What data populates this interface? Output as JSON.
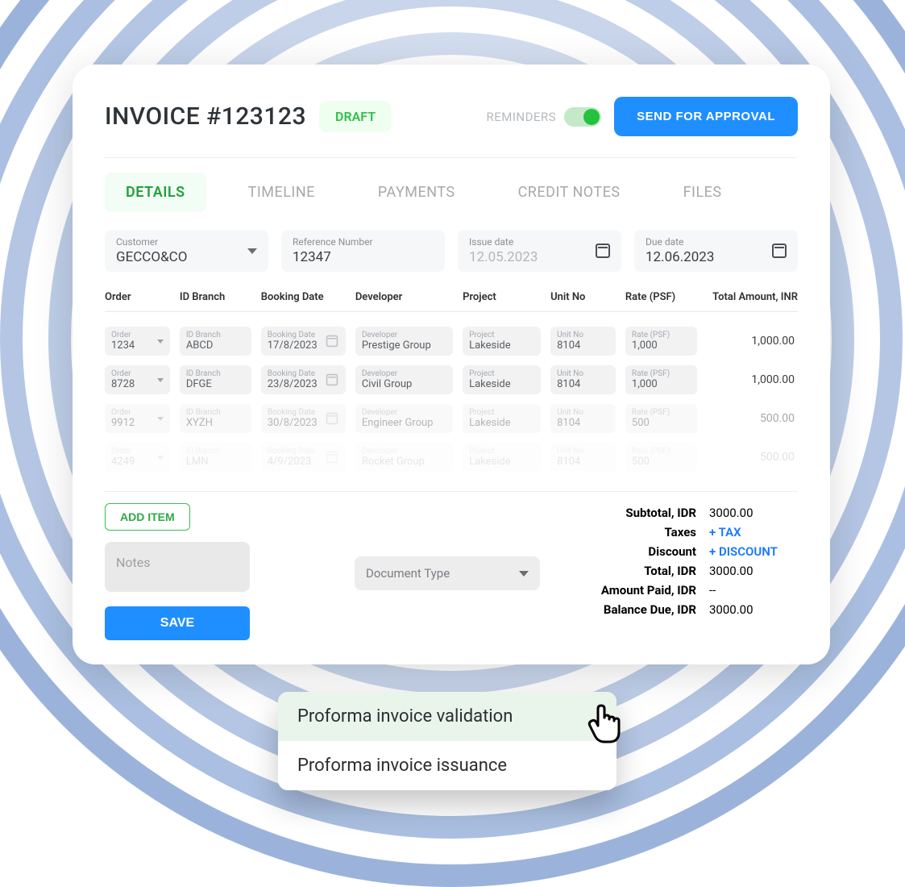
{
  "header": {
    "title": "INVOICE #123123",
    "status": "DRAFT",
    "reminders_label": "REMINDERS",
    "approve_label": "SEND FOR APPROVAL"
  },
  "tabs": [
    "DETAILS",
    "TIMELINE",
    "PAYMENTS",
    "CREDIT NOTES",
    "FILES"
  ],
  "fields": {
    "customer": {
      "label": "Customer",
      "value": "GECCO&CO"
    },
    "reference": {
      "label": "Reference Number",
      "value": "12347"
    },
    "issue": {
      "label": "Issue date",
      "value": "12.05.2023"
    },
    "due": {
      "label": "Due date",
      "value": "12.06.2023"
    }
  },
  "columns": [
    "Order",
    "ID Branch",
    "Booking Date",
    "Developer",
    "Project",
    "Unit No",
    "Rate (PSF)",
    "Total Amount, INR"
  ],
  "lines": [
    {
      "order": "1234",
      "branch": "ABCD",
      "booking": "17/8/2023",
      "developer": "Prestige Group",
      "project": "Lakeside",
      "unit": "8104",
      "rate": "1,000",
      "amount": "1,000.00",
      "fade": ""
    },
    {
      "order": "8728",
      "branch": "DFGE",
      "booking": "23/8/2023",
      "developer": "Civil Group",
      "project": "Lakeside",
      "unit": "8104",
      "rate": "1,000",
      "amount": "1,000.00",
      "fade": ""
    },
    {
      "order": "9912",
      "branch": "XYZH",
      "booking": "30/8/2023",
      "developer": "Engineer Group",
      "project": "Lakeside",
      "unit": "8104",
      "rate": "500",
      "amount": "500.00",
      "fade": "fade2"
    },
    {
      "order": "4249",
      "branch": "LMN",
      "booking": "4/9/2023",
      "developer": "Rocket Group",
      "project": "Lakeside",
      "unit": "8104",
      "rate": "500",
      "amount": "500.00",
      "fade": "fade3"
    }
  ],
  "cell_labels": {
    "order": "Order",
    "branch": "ID Branch",
    "booking": "Booking Date",
    "developer": "Developer",
    "project": "Project",
    "unit": "Unit No",
    "rate": "Rate (PSF)"
  },
  "actions": {
    "add_item": "ADD ITEM",
    "notes_placeholder": "Notes",
    "doctype_label": "Document Type",
    "save": "SAVE"
  },
  "totals": [
    {
      "label": "Subtotal, IDR",
      "value": "3000.00",
      "link": false
    },
    {
      "label": "Taxes",
      "value": "+ TAX",
      "link": true
    },
    {
      "label": "Discount",
      "value": "+ DISCOUNT",
      "link": true
    },
    {
      "label": "Total, IDR",
      "value": "3000.00",
      "link": false
    },
    {
      "label": "Amount Paid, IDR",
      "value": "--",
      "link": false
    },
    {
      "label": "Balance Due, IDR",
      "value": "3000.00",
      "link": false
    }
  ],
  "doctype_options": [
    {
      "label": "Proforma invoice validation",
      "selected": true
    },
    {
      "label": "Proforma invoice issuance",
      "selected": false
    }
  ]
}
